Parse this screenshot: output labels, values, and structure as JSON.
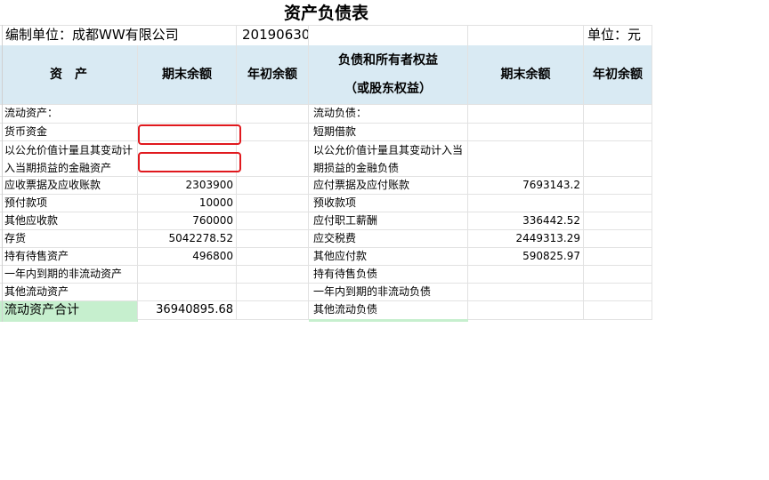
{
  "sheet": {
    "title": "资产负债表",
    "unit_label": "编制单位：成都WW有限公司",
    "date": "20190630",
    "currency": "单位：元"
  },
  "header": {
    "assets": "资　产",
    "end_balance": "期末余额",
    "begin_balance": "年初余额",
    "liabilities_line1": "负债和所有者权益",
    "liabilities_line2": "（或股东权益）",
    "end_balance_2": "期末余额",
    "begin_balance_2": "年初余额"
  },
  "rows": [
    {
      "a": "流动资产：",
      "b": "",
      "c": "",
      "d": "流动负债：",
      "e": "",
      "f": ""
    },
    {
      "a": "货币资金",
      "b": "",
      "c": "",
      "d": "短期借款",
      "e": "",
      "f": ""
    },
    {
      "a": "以公允价值计量且其变动计入当期损益的金融资产",
      "b": "",
      "c": "",
      "d": "以公允价值计量且其变动计入当期损益的金融负债",
      "e": "",
      "f": ""
    },
    {
      "a": "应收票据及应收账款",
      "b": "2303900",
      "c": "",
      "d": "应付票据及应付账款",
      "e": "7693143.2",
      "f": ""
    },
    {
      "a": "预付款项",
      "b": "10000",
      "c": "",
      "d": "预收款项",
      "e": "",
      "f": ""
    },
    {
      "a": "其他应收款",
      "b": "760000",
      "c": "",
      "d": "应付职工薪酬",
      "e": "336442.52",
      "f": ""
    },
    {
      "a": "存货",
      "b": "5042278.52",
      "c": "",
      "d": "应交税费",
      "e": "2449313.29",
      "f": ""
    },
    {
      "a": "持有待售资产",
      "b": "496800",
      "c": "",
      "d": "其他应付款",
      "e": "590825.97",
      "f": ""
    },
    {
      "a": "一年内到期的非流动资产",
      "b": "",
      "c": "",
      "d": "持有待售负债",
      "e": "",
      "f": ""
    },
    {
      "a": "其他流动资产",
      "b": "",
      "c": "",
      "d": "一年内到期的非流动负债",
      "e": "",
      "f": ""
    },
    {
      "a": "流动资产合计",
      "b": "36940895.68",
      "c": "",
      "d": "其他流动负债",
      "e": "",
      "f": ""
    }
  ],
  "colors": {
    "header_bg": "#d9eaf3",
    "total_bg": "#c6efce",
    "highlight": "#e0191e"
  }
}
